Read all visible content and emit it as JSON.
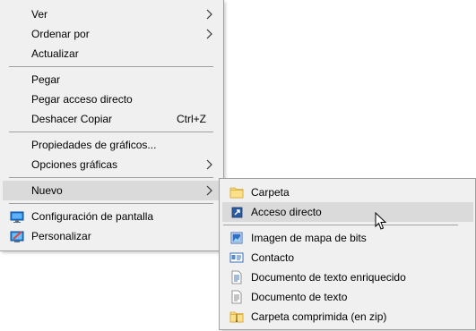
{
  "main_menu": {
    "ver": "Ver",
    "ordenar_por": "Ordenar por",
    "actualizar": "Actualizar",
    "pegar": "Pegar",
    "pegar_acceso_directo": "Pegar acceso directo",
    "deshacer_copiar": "Deshacer Copiar",
    "deshacer_copiar_shortcut": "Ctrl+Z",
    "propiedades_graficos": "Propiedades de gráficos...",
    "opciones_graficas": "Opciones gráficas",
    "nuevo": "Nuevo",
    "configuracion_pantalla": "Configuración de pantalla",
    "personalizar": "Personalizar"
  },
  "sub_menu": {
    "carpeta": "Carpeta",
    "acceso_directo": "Acceso directo",
    "imagen_mapa_bits": "Imagen de mapa de bits",
    "contacto": "Contacto",
    "documento_texto_enriquecido": "Documento de texto enriquecido",
    "documento_texto": "Documento de texto",
    "carpeta_comprimida": "Carpeta comprimida (en zip)"
  },
  "colors": {
    "menu_background": "#f0f0f0",
    "highlight": "#dadada",
    "separator": "#a0a0a0"
  },
  "icons": {
    "carpeta": "folder-icon",
    "acceso_directo": "shortcut-icon",
    "imagen_mapa_bits": "bitmap-icon",
    "contacto": "contact-card-icon",
    "documento_texto_enriquecido": "rich-text-document-icon",
    "documento_texto": "text-document-icon",
    "carpeta_comprimida": "zip-folder-icon",
    "configuracion_pantalla": "display-settings-icon",
    "personalizar": "personalize-icon"
  }
}
